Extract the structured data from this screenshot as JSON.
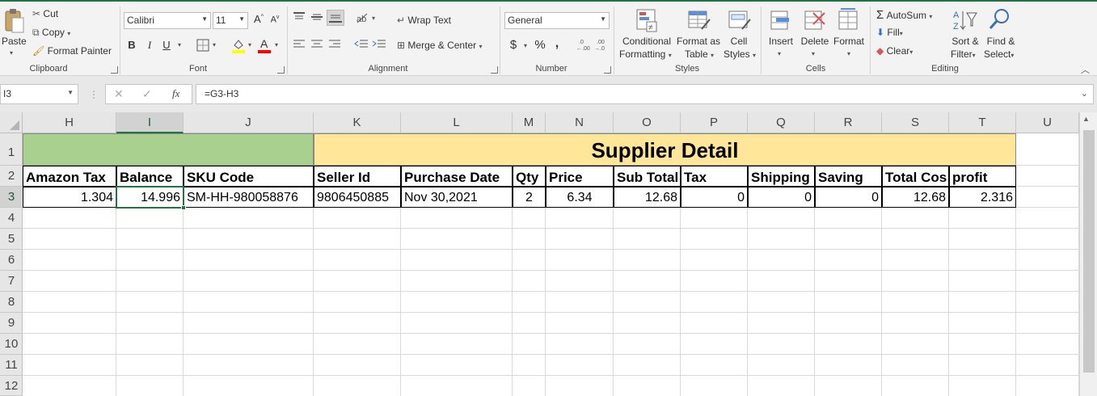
{
  "ribbon": {
    "clipboard": {
      "paste": "Paste",
      "cut": "Cut",
      "copy": "Copy",
      "format_painter": "Format Painter",
      "label": "Clipboard"
    },
    "font": {
      "name": "Calibri",
      "size": "11",
      "bold": "B",
      "italic": "I",
      "underline": "U",
      "label": "Font"
    },
    "alignment": {
      "wrap_text": "Wrap Text",
      "merge_center": "Merge & Center",
      "label": "Alignment"
    },
    "number": {
      "format": "General",
      "currency": "$",
      "percent": "%",
      "comma": ",",
      "label": "Number"
    },
    "styles": {
      "conditional_1": "Conditional",
      "conditional_2": "Formatting",
      "format_table_1": "Format as",
      "format_table_2": "Table",
      "cell_styles_1": "Cell",
      "cell_styles_2": "Styles",
      "label": "Styles"
    },
    "cells": {
      "insert": "Insert",
      "delete": "Delete",
      "format": "Format",
      "label": "Cells"
    },
    "editing": {
      "autosum": "AutoSum",
      "fill": "Fill",
      "clear": "Clear",
      "sort_1": "Sort &",
      "sort_2": "Filter",
      "find_1": "Find &",
      "find_2": "Select",
      "label": "Editing"
    }
  },
  "formula_bar": {
    "name_box": "I3",
    "formula": "=G3-H3",
    "fx": "fx"
  },
  "columns": [
    "H",
    "I",
    "J",
    "K",
    "L",
    "M",
    "N",
    "O",
    "P",
    "Q",
    "R",
    "S",
    "T",
    "U"
  ],
  "rows": [
    "1",
    "2",
    "3",
    "4",
    "5",
    "6",
    "7",
    "8",
    "9",
    "10",
    "11",
    "12"
  ],
  "sheet": {
    "title": "Supplier Detail",
    "headers": [
      "Amazon Tax",
      "Balance",
      "SKU Code",
      "Seller Id",
      "Purchase Date",
      "Qty",
      "Price",
      "Sub Total",
      "Tax",
      "Shipping",
      "Saving",
      "Total Cos",
      "profit"
    ],
    "row3": [
      "1.304",
      "14.996",
      "SM-HH-980058876",
      "9806450885",
      "Nov 30,2021",
      "2",
      "6.34",
      "12.68",
      "0",
      "0",
      "0",
      "12.68",
      "2.316"
    ]
  },
  "colors": {
    "accent": "#217346",
    "green_fill": "#a9d08e",
    "yellow_fill": "#ffe699"
  }
}
